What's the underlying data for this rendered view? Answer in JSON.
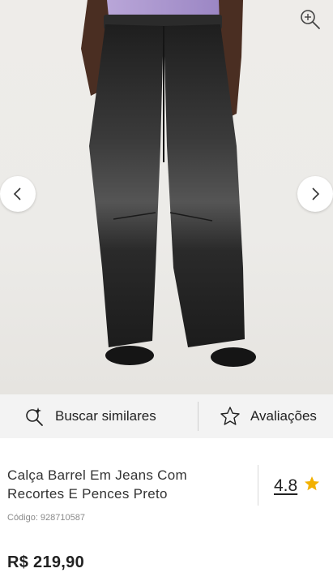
{
  "product": {
    "title_line1": "Calça Barrel Em Jeans Com",
    "title_line2": "Recortes E Pences Preto",
    "rating": "4.8",
    "code_label": "Código:",
    "code_value": "928710587",
    "price": "R$ 219,90"
  },
  "actions": {
    "similar_label": "Buscar similares",
    "reviews_label": "Avaliações"
  },
  "colors": {
    "star": "#f2b100",
    "action_bar_bg": "#f3f3f3",
    "photo_bg": "#eceae7",
    "jeans": "#2a2a2a"
  },
  "icons": {
    "zoom": "zoom-in-icon",
    "prev": "chevron-left-icon",
    "next": "chevron-right-icon",
    "similar": "sparkle-search-icon",
    "reviews": "star-outline-icon",
    "rating": "star-filled-icon"
  }
}
